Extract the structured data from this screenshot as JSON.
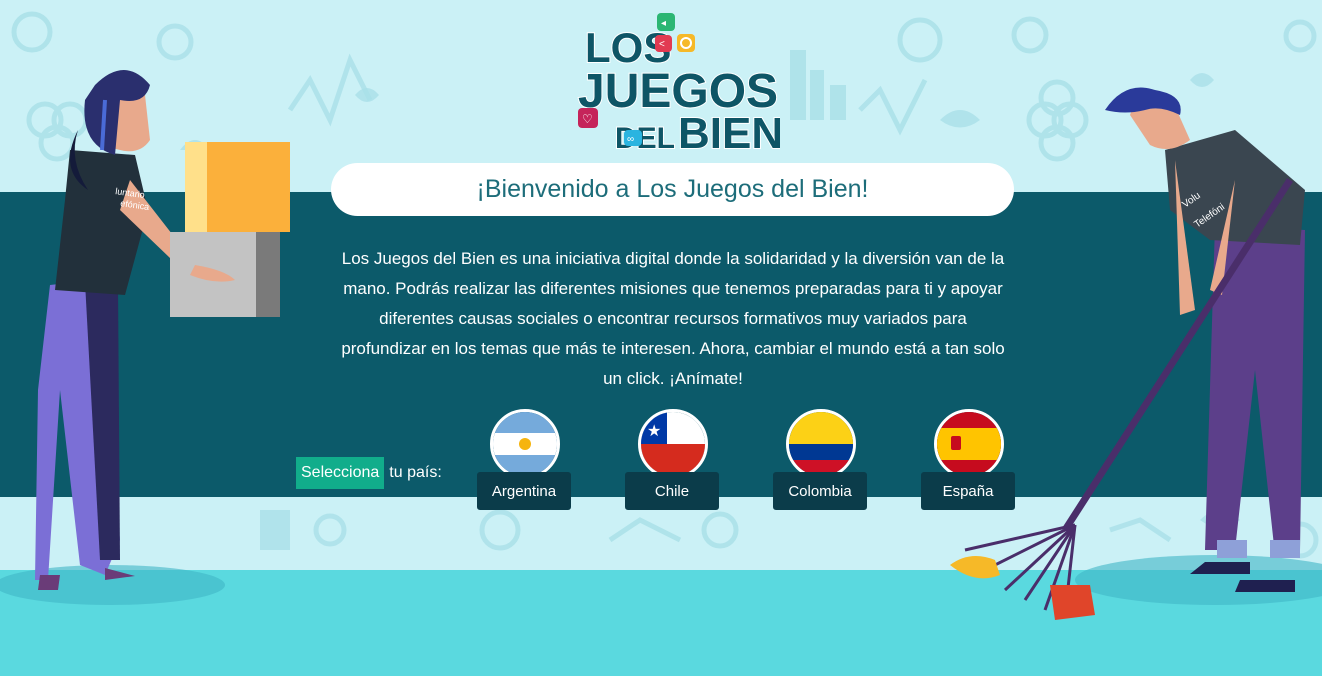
{
  "header": {
    "logo_line1": "LOS",
    "logo_line2": "JUEGOS",
    "logo_line3_a": "DEL",
    "logo_line3_b": "BIEN",
    "logo_icons": [
      "speaker-icon",
      "share-icon",
      "coin-icon",
      "heart-icon",
      "link-icon"
    ]
  },
  "welcome": {
    "title": "¡Bienvenido a Los Juegos del Bien!"
  },
  "intro": {
    "line1": "Los Juegos del Bien es una iniciativa digital donde la solidaridad y la diversión van de la",
    "line2": "mano. Podrás realizar las diferentes misiones que tenemos preparadas para ti y apoyar",
    "line3": "diferentes causas sociales o encontrar recursos formativos muy variados para",
    "line4": "profundizar en los temas que más te interesen. Ahora, cambiar el mundo está a tan solo",
    "line5": "un click. ¡Anímate!"
  },
  "country_select": {
    "highlight": "Selecciona",
    "rest": "tu país:",
    "countries": [
      {
        "label": "Argentina",
        "flag": "argentina-flag-icon"
      },
      {
        "label": "Chile",
        "flag": "chile-flag-icon"
      },
      {
        "label": "Colombia",
        "flag": "colombia-flag-icon"
      },
      {
        "label": "España",
        "flag": "spain-flag-icon"
      }
    ]
  },
  "illustration": {
    "left_shirt_line1": "luntario",
    "left_shirt_line2": "efónica",
    "right_shirt_line1": "Volu",
    "right_shirt_line2": "Telefóni"
  },
  "colors": {
    "sky": "#cbf1f6",
    "band": "#0c5a6a",
    "floor": "#5ad9df",
    "select_highlight": "#11ad8b",
    "country_button": "#0b3c4a",
    "logo_text": "#0e5566"
  }
}
